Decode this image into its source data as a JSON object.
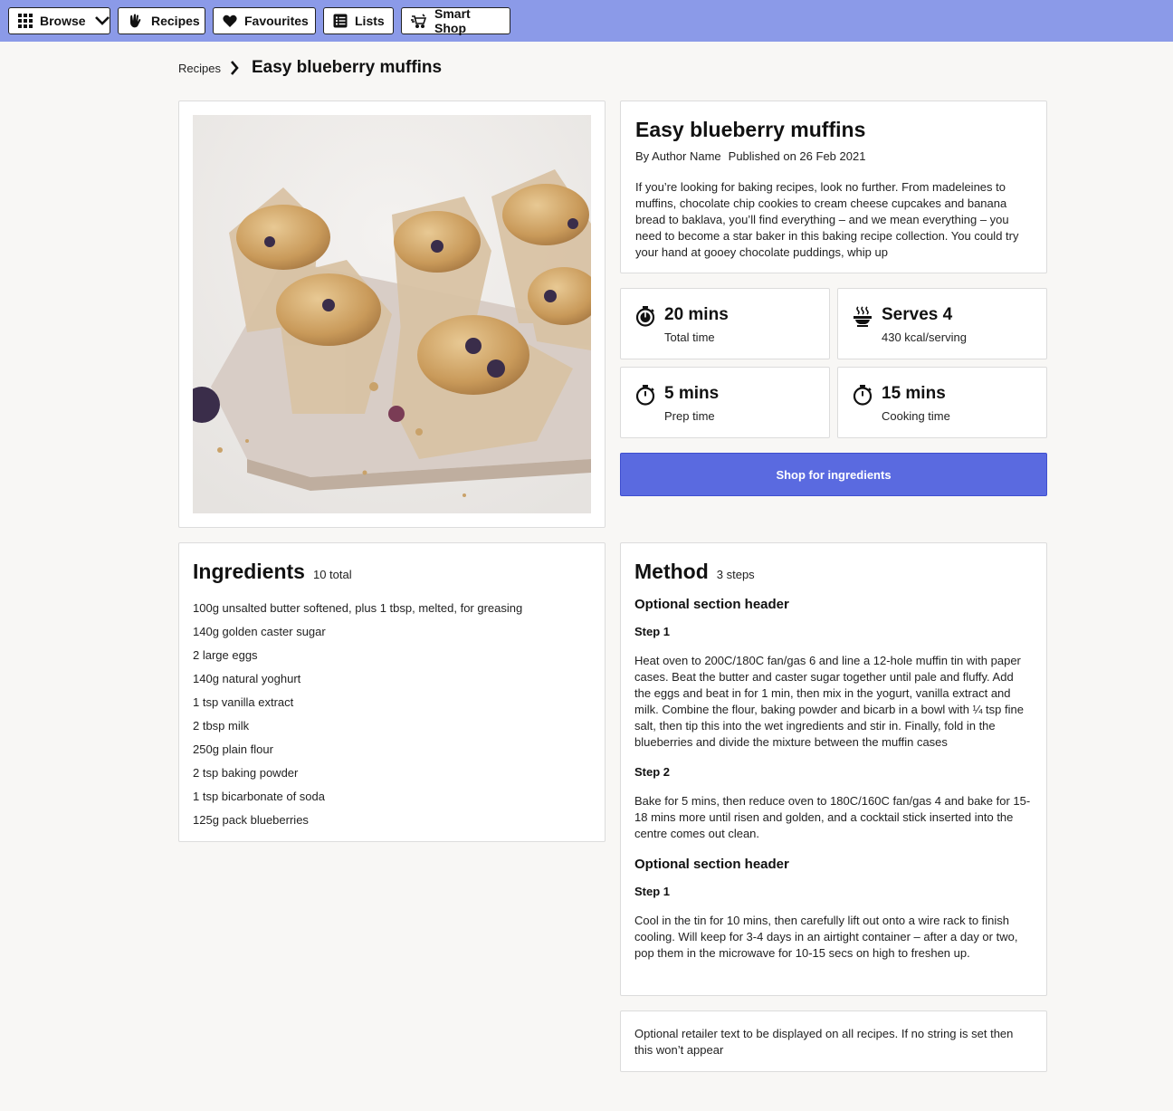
{
  "nav": {
    "items": [
      {
        "label": "Browse",
        "icon": "grid-icon"
      },
      {
        "label": "Recipes",
        "icon": "hand-pan-icon"
      },
      {
        "label": "Favourites",
        "icon": "heart-icon"
      },
      {
        "label": "Lists",
        "icon": "list-icon"
      },
      {
        "label": "Smart Shop",
        "icon": "smart-shop-icon"
      }
    ]
  },
  "breadcrumb": {
    "root": "Recipes",
    "current": "Easy blueberry muffins"
  },
  "recipe": {
    "title": "Easy blueberry muffins",
    "author": "By Author Name",
    "published": "Published on 26 Feb 2021",
    "description": "If you’re looking for baking recipes, look no further. From madeleines to muffins, chocolate chip cookies to cream cheese cupcakes and banana bread to baklava, you’ll find everything – and we mean everything – you need to become a star baker in this baking recipe collection. You could try your hand at gooey chocolate puddings, whip up"
  },
  "stats": [
    {
      "value": "20 mins",
      "label": "Total time",
      "icon": "stopwatch-filled-icon"
    },
    {
      "value": "Serves 4",
      "label": "430 kcal/serving",
      "icon": "steaming-bowl-icon"
    },
    {
      "value": "5 mins",
      "label": "Prep time",
      "icon": "stopwatch-icon"
    },
    {
      "value": "15 mins",
      "label": "Cooking time",
      "icon": "stopwatch-icon"
    }
  ],
  "shop_button": "Shop for ingredients",
  "ingredients": {
    "title": "Ingredients",
    "count": "10 total",
    "items": [
      "100g unsalted butter softened, plus 1 tbsp, melted, for greasing",
      "140g golden caster sugar",
      "2 large eggs",
      "140g natural yoghurt",
      "1 tsp vanilla extract",
      "2 tbsp milk",
      "250g plain flour",
      "2 tsp baking powder",
      "1 tsp bicarbonate of soda",
      "125g pack blueberries"
    ]
  },
  "method": {
    "title": "Method",
    "count": "3 steps",
    "sections": [
      {
        "header": "Optional section header",
        "steps": [
          {
            "label": "Step 1",
            "text": "Heat oven to 200C/180C fan/gas 6 and line a 12-hole muffin tin with paper cases. Beat the butter and caster sugar together until pale and fluffy. Add the eggs and beat in for 1 min, then mix in the yogurt, vanilla extract and milk. Combine the flour, baking powder and bicarb in a bowl with ¼ tsp fine salt, then tip this into the wet ingredients and stir in. Finally, fold in the blueberries and divide the mixture between the muffin cases"
          },
          {
            "label": "Step 2",
            "text": "Bake for 5 mins, then reduce oven to 180C/160C fan/gas 4 and bake for 15-18 mins more until risen and golden, and a cocktail stick inserted into the centre comes out clean."
          }
        ]
      },
      {
        "header": "Optional section header",
        "steps": [
          {
            "label": "Step 1",
            "text": "Cool in the tin for 10 mins, then carefully lift out onto a wire rack to finish cooling. Will keep for 3-4 days in an airtight container – after a day or two, pop them in the microwave for 10-15 secs on high to freshen up."
          }
        ]
      }
    ]
  },
  "retailer_text": "Optional retailer text to be displayed on all recipes. If no string is set then this won’t appear",
  "colors": {
    "topbar": "#8b9ae8",
    "accent_button": "#5a6ae0",
    "page_bg": "#f8f7f5"
  }
}
